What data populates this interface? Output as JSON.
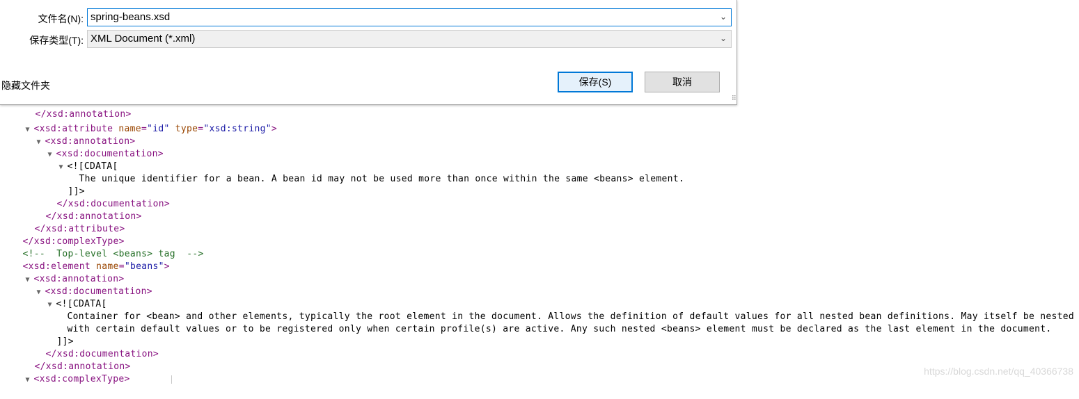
{
  "dialog": {
    "filename_label": "文件名(N):",
    "filename_value": "spring-beans.xsd",
    "savetype_label": "保存类型(T):",
    "savetype_value": "XML Document (*.xml)",
    "hide_folders": "隐藏文件夹",
    "save_button": "保存(S)",
    "cancel_button": "取消"
  },
  "xml_lines": [
    "</xsd:annotation>",
    "<xsd:attribute name=\"id\" type=\"xsd:string\">",
    "<xsd:annotation>",
    "<xsd:documentation>",
    "<![CDATA[",
    "The unique identifier for a bean. A bean id may not be used more than once within the same <beans> element.",
    "]]>",
    "</xsd:documentation>",
    "</xsd:annotation>",
    "</xsd:attribute>",
    "</xsd:complexType>",
    "<!--  Top-level <beans> tag  -->",
    "<xsd:element name=\"beans\">",
    "<xsd:annotation>",
    "<xsd:documentation>",
    "<![CDATA[",
    "Container for <bean> and other elements, typically the root element in the document. Allows the definition of default values for all nested bean definitions. May itself be nested for the",
    "with certain default values or to be registered only when certain profile(s) are active. Any such nested <beans> element must be declared as the last element in the document.",
    "]]>",
    "</xsd:documentation>",
    "</xsd:annotation>",
    "<xsd:complexType>"
  ],
  "xml_colors": {
    "tag": "#881280",
    "attr_name": "#994500",
    "attr_value": "#1a1aa6",
    "comment": "#236e25"
  },
  "watermark": "https://blog.csdn.net/qq_40366738",
  "icons": {
    "expand_toggle": "triangle-down-icon",
    "dropdown": "chevron-down-icon",
    "resize": "resize-grip-icon"
  }
}
